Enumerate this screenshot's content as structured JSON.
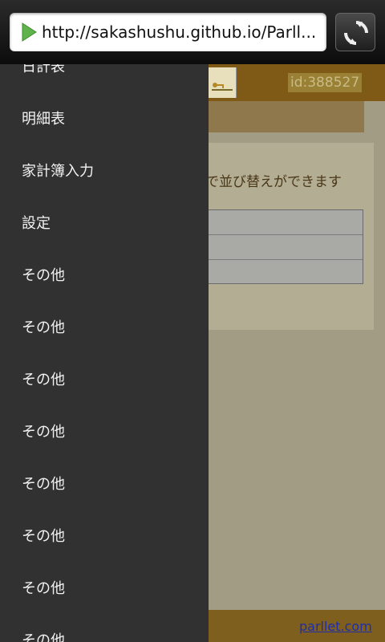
{
  "browser": {
    "url": "http://sakashushu.github.io/Parll...",
    "play_icon": "play-triangle-icon",
    "refresh_icon": "refresh-icon"
  },
  "page": {
    "user_id": "id:388527",
    "sort_hint": "で並び替えができます",
    "footer_link": "parllet.com"
  },
  "drawer": {
    "items": [
      {
        "label": "日計表"
      },
      {
        "label": "明細表"
      },
      {
        "label": "家計簿入力"
      },
      {
        "label": "設定"
      },
      {
        "label": "その他"
      },
      {
        "label": "その他"
      },
      {
        "label": "その他"
      },
      {
        "label": "その他"
      },
      {
        "label": "その他"
      },
      {
        "label": "その他"
      },
      {
        "label": "その他"
      },
      {
        "label": "その他"
      }
    ]
  },
  "colors": {
    "drawer_bg": "#313131",
    "header_brown": "#7e5a16",
    "page_bg": "#a29c84",
    "link": "#1f2ea8"
  }
}
